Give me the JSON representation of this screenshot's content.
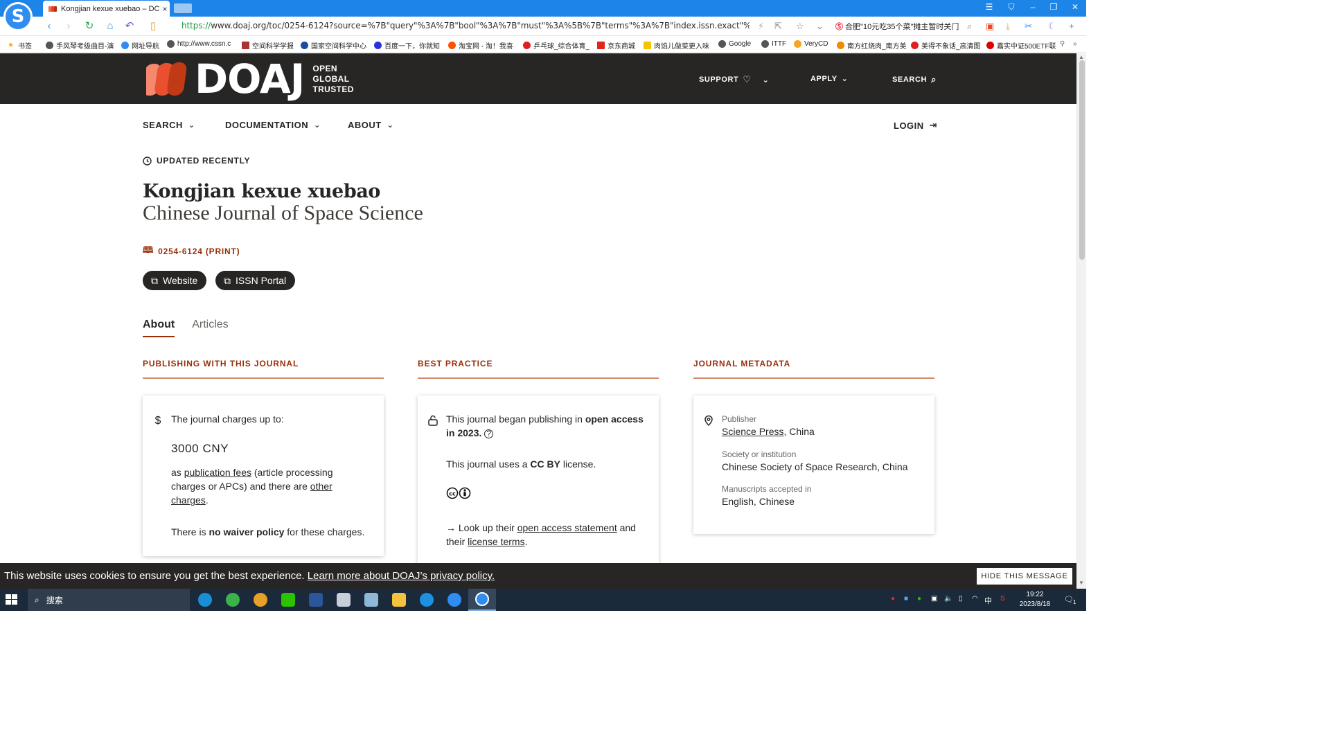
{
  "browser": {
    "tab_title": "Kongjian kexue xuebao – DC",
    "tab_close": "×",
    "url_scheme": "https://",
    "url_rest": "www.doaj.org/toc/0254-6124?source=%7B\"query\"%3A%7B\"bool\"%3A%7B\"must\"%3A%5B%7B\"terms\"%3A%7B\"index.issn.exact\"%3A%5B\"0254-",
    "news_ticker": "合肥\"10元吃35个菜\"摊主暂时关门",
    "window_controls": [
      "☰",
      "⛉",
      "–",
      "❐",
      "✕"
    ],
    "bookmarks": [
      "书签",
      "手风琴考级曲目-演",
      "网址导航",
      "http://www.cssn.c",
      "空间科学学报",
      "国家空间科学中心",
      "百度一下，你就知",
      "淘宝网 - 淘！我喜",
      "乒乓球_综合体育_",
      "京东商城",
      "肉馅儿做菜更入味",
      "Google",
      "ITTF",
      "VeryCD",
      "南方红烧肉_南方美",
      "美得不象话_高清图",
      "嘉实中证500ETF联"
    ]
  },
  "doaj": {
    "logo_word": "DOAJ",
    "logo_tag": [
      "OPEN",
      "GLOBAL",
      "TRUSTED"
    ],
    "header_nav": {
      "support": "SUPPORT",
      "apply": "APPLY",
      "search": "SEARCH"
    },
    "subnav": {
      "search": "SEARCH",
      "documentation": "DOCUMENTATION",
      "about": "ABOUT",
      "login": "LOGIN"
    },
    "updated_label": "UPDATED RECENTLY",
    "journal_title": "Kongjian kexue xuebao",
    "journal_alt_title": "Chinese Journal of Space Science",
    "issn": "0254-6124 (PRINT)",
    "buttons": {
      "website": "Website",
      "issn_portal": "ISSN Portal"
    },
    "tabs": {
      "about": "About",
      "articles": "Articles"
    },
    "sections": {
      "publishing": "PUBLISHING WITH THIS JOURNAL",
      "best_practice": "BEST PRACTICE",
      "metadata": "JOURNAL METADATA"
    },
    "publishing_card": {
      "charges_intro": "The journal charges up to:",
      "amount": "3000 CNY",
      "as": "as",
      "pub_fees_link": "publication fees",
      "apc_text": "(article processing charges or APCs) and there are",
      "other_link": "other",
      "charges_link": "charges",
      "period": ".",
      "waiver_pre": "There is",
      "waiver_bold": "no waiver policy",
      "waiver_post": "for these charges."
    },
    "practice_card": {
      "oa_pre": "This journal began publishing in",
      "oa_bold": "open access",
      "oa_year": "in 2023.",
      "license_pre": "This journal uses a",
      "license_bold": "CC BY",
      "license_post": "license.",
      "lookup_pre": "→ Look up their",
      "oa_statement_link": "open access statement",
      "and": "and",
      "their": "their",
      "license_terms_link": "license terms",
      "period": "."
    },
    "metadata_card": {
      "publisher_label": "Publisher",
      "publisher_link": "Science Press",
      "publisher_country": ", China",
      "society_label": "Society or institution",
      "society_value": "Chinese Society of Space Research, China",
      "manuscripts_label": "Manuscripts accepted in",
      "manuscripts_value": "English, Chinese"
    },
    "cookie": {
      "message": "This website uses cookies to ensure you get the best experience.",
      "link": "Learn more about DOAJ’s privacy policy.",
      "hide_button": "HIDE THIS MESSAGE"
    }
  },
  "taskbar": {
    "search_label": "搜索",
    "time": "19:22",
    "date": "2023/8/18",
    "ime": "中",
    "notifications": "1"
  },
  "colors": {
    "doaj_dark": "#282624",
    "doaj_accent": "#982e0a",
    "browser_blue": "#1d84e8"
  }
}
